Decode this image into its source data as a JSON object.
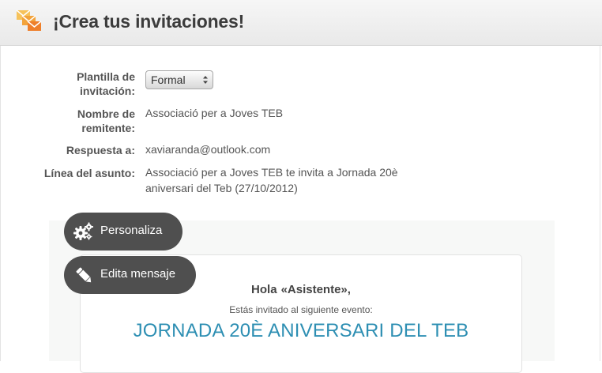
{
  "header": {
    "title": "¡Crea tus invitaciones!",
    "logo_icon": "envelopes-icon",
    "logo_colors": [
      "#f4b04a",
      "#ee7f2a"
    ]
  },
  "form": {
    "template": {
      "label_line1": "Plantilla de",
      "label_line2": "invitación:",
      "value": "Formal"
    },
    "sender": {
      "label_line1": "Nombre de",
      "label_line2": "remitente:",
      "value": "Associació per a Joves TEB"
    },
    "reply_to": {
      "label": "Respuesta a:",
      "value": "xaviaranda@outlook.com"
    },
    "subject": {
      "label": "Línea del asunto:",
      "value_line1": "Associació per a Joves TEB te invita a Jornada 20è",
      "value_line2": "aniversari del Teb (27/10/2012)"
    }
  },
  "actions": {
    "customize": {
      "label": "Personaliza",
      "icon": "gears-icon"
    },
    "edit_message": {
      "label": "Edita mensaje",
      "icon": "pencil-icon"
    }
  },
  "preview": {
    "greeting": "Hola",
    "attendee": "«Asistente»,",
    "invited_text": "Estás invitado al siguiente evento:",
    "event_title": "JORNADA 20È ANIVERSARI DEL TEB",
    "title_color": "#2e8fb3"
  }
}
